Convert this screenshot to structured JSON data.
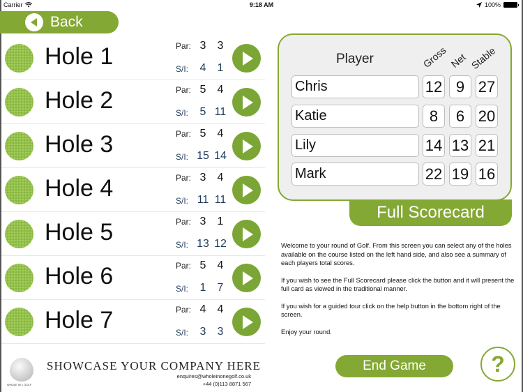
{
  "status_bar": {
    "carrier": "Carrier",
    "time": "9:18 AM",
    "battery": "100%"
  },
  "back_button": {
    "label": "Back"
  },
  "holes": [
    {
      "name": "Hole 1",
      "par_label": "Par:",
      "si_label": "S/I:",
      "par": [
        "3",
        "3"
      ],
      "si": [
        "4",
        "1"
      ]
    },
    {
      "name": "Hole 2",
      "par_label": "Par:",
      "si_label": "S/I:",
      "par": [
        "5",
        "4"
      ],
      "si": [
        "5",
        "11"
      ]
    },
    {
      "name": "Hole 3",
      "par_label": "Par:",
      "si_label": "S/I:",
      "par": [
        "5",
        "4"
      ],
      "si": [
        "15",
        "14"
      ]
    },
    {
      "name": "Hole 4",
      "par_label": "Par:",
      "si_label": "S/I:",
      "par": [
        "3",
        "4"
      ],
      "si": [
        "11",
        "11"
      ]
    },
    {
      "name": "Hole 5",
      "par_label": "Par:",
      "si_label": "S/I:",
      "par": [
        "3",
        "1"
      ],
      "si": [
        "13",
        "12"
      ]
    },
    {
      "name": "Hole 6",
      "par_label": "Par:",
      "si_label": "S/I:",
      "par": [
        "5",
        "4"
      ],
      "si": [
        "1",
        "7"
      ]
    },
    {
      "name": "Hole 7",
      "par_label": "Par:",
      "si_label": "S/I:",
      "par": [
        "4",
        "4"
      ],
      "si": [
        "3",
        "3"
      ]
    }
  ],
  "branding": {
    "logo_text": "WHOLE IN 1 GOLF",
    "title": "SHOWCASE YOUR COMPANY HERE",
    "email": "enquires@wholeinonegolf.co.uk",
    "phone": "+44 (0)113 8871 567"
  },
  "scores": {
    "headers": {
      "player": "Player",
      "gross": "Gross",
      "net": "Net",
      "stable": "Stable"
    },
    "players": [
      {
        "name": "Chris",
        "gross": "12",
        "net": "9",
        "stable": "27"
      },
      {
        "name": "Katie",
        "gross": "8",
        "net": "6",
        "stable": "20"
      },
      {
        "name": "Lily",
        "gross": "14",
        "net": "13",
        "stable": "21"
      },
      {
        "name": "Mark",
        "gross": "22",
        "net": "19",
        "stable": "16"
      }
    ]
  },
  "full_scorecard_button": {
    "label": "Full Scorecard"
  },
  "info": {
    "paragraphs": [
      "Welcome to your round of Golf. From this screen you can select any of the holes available on the course listed on the left hand side, and also see a summary of each players total scores.",
      "If you wish to see the Full Scorecard please click the button and it will present the full card as viewed in the traditional manner.",
      "If you wish for a guided tour click on the help button in the bottom right of the screen.",
      "Enjoy your round."
    ]
  },
  "end_game_button": {
    "label": "End Game"
  },
  "help_button": {
    "label": "?"
  },
  "colors": {
    "accent_green": "#84a834",
    "si_blue": "#1f3a5a"
  }
}
